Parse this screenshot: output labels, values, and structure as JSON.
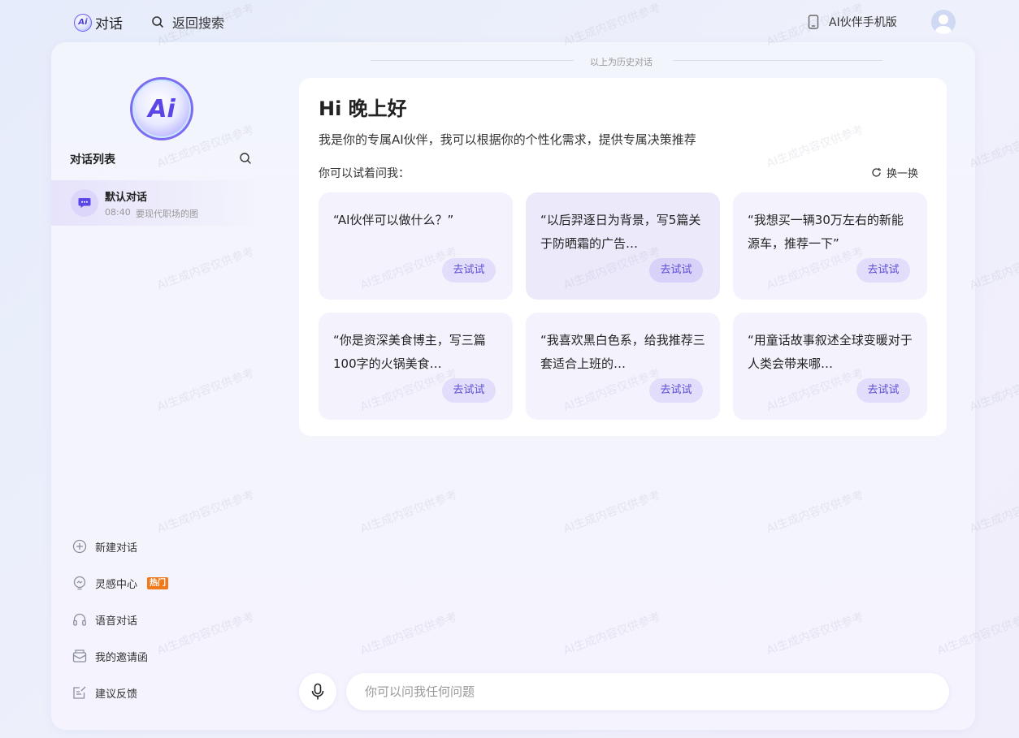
{
  "header": {
    "brand_logo": "Ai",
    "brand_title": "对话",
    "back_search": "返回搜索",
    "mobile_version": "AI伙伴手机版"
  },
  "sidebar": {
    "logo_text": "Ai",
    "list_title": "对话列表",
    "conversations": [
      {
        "title": "默认对话",
        "time": "08:40",
        "preview": "要现代职场的图"
      }
    ],
    "menu": [
      {
        "label": "新建对话",
        "icon": "plus-circle-icon"
      },
      {
        "label": "灵感中心",
        "icon": "lightbulb-icon",
        "badge": "热门"
      },
      {
        "label": "语音对话",
        "icon": "headphones-icon"
      },
      {
        "label": "我的邀请函",
        "icon": "envelope-icon"
      },
      {
        "label": "建议反馈",
        "icon": "feedback-icon"
      }
    ]
  },
  "main": {
    "history_divider": "以上为历史对话",
    "greeting": "Hi 晚上好",
    "intro": "我是你的专属AI伙伴，我可以根据你的个性化需求，提供专属决策推荐",
    "ask_label": "你可以试着问我：",
    "refresh_label": "换一换",
    "try_label": "去试试",
    "prompts": [
      "“AI伙伴可以做什么？”",
      "“以后羿逐日为背景，写5篇关于防晒霜的广告…",
      "“我想买一辆30万左右的新能源车，推荐一下”",
      "“你是资深美食博主，写三篇100字的火锅美食…",
      "“我喜欢黑白色系，给我推荐三套适合上班的…",
      "“用童话故事叙述全球变暖对于人类会带来哪…"
    ],
    "input_placeholder": "你可以问我任何问题"
  },
  "watermark": "AI生成内容仅供参考",
  "colors": {
    "accent": "#5b4fd6",
    "hot_badge": "#f07a1b",
    "active_card": "#ece9fb"
  }
}
